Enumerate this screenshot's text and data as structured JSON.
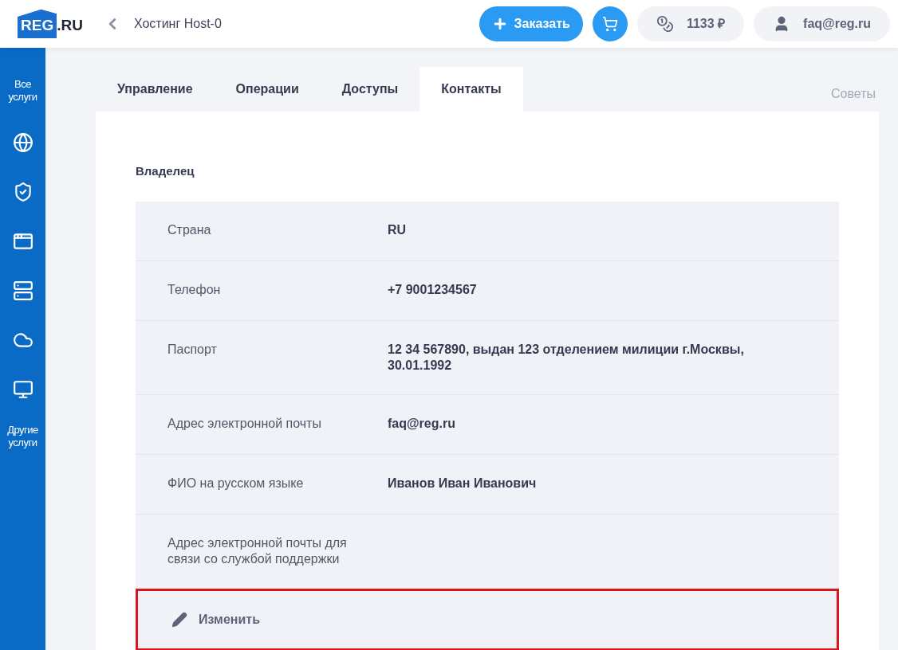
{
  "header": {
    "logo": {
      "main": "REG",
      "suffix": ".RU"
    },
    "title": "Хостинг Host-0",
    "order_button": "Заказать",
    "balance": "1133 ₽",
    "account": "faq@reg.ru"
  },
  "sidebar": {
    "top_label": "Все услуги",
    "bottom_label": "Другие услуги"
  },
  "tabs": [
    {
      "label": "Управление",
      "selected": false
    },
    {
      "label": "Операции",
      "selected": false
    },
    {
      "label": "Доступы",
      "selected": false
    },
    {
      "label": "Контакты",
      "selected": true
    }
  ],
  "tips_link": "Советы",
  "section": {
    "title": "Владелец",
    "rows": [
      {
        "label": "Страна",
        "value": "RU"
      },
      {
        "label": "Телефон",
        "value": "+7 9001234567"
      },
      {
        "label": "Паспорт",
        "value": "12 34 567890, выдан 123 отделением милиции г.Москвы, 30.01.1992"
      },
      {
        "label": "Адрес электронной почты",
        "value": "faq@reg.ru"
      },
      {
        "label": "ФИО на русском языке",
        "value": "Иванов Иван Иванович"
      },
      {
        "label": "Адрес электронной почты для связи со службой поддержки"
      }
    ],
    "edit": {
      "label": "Изменить",
      "highlighted": true
    }
  }
}
